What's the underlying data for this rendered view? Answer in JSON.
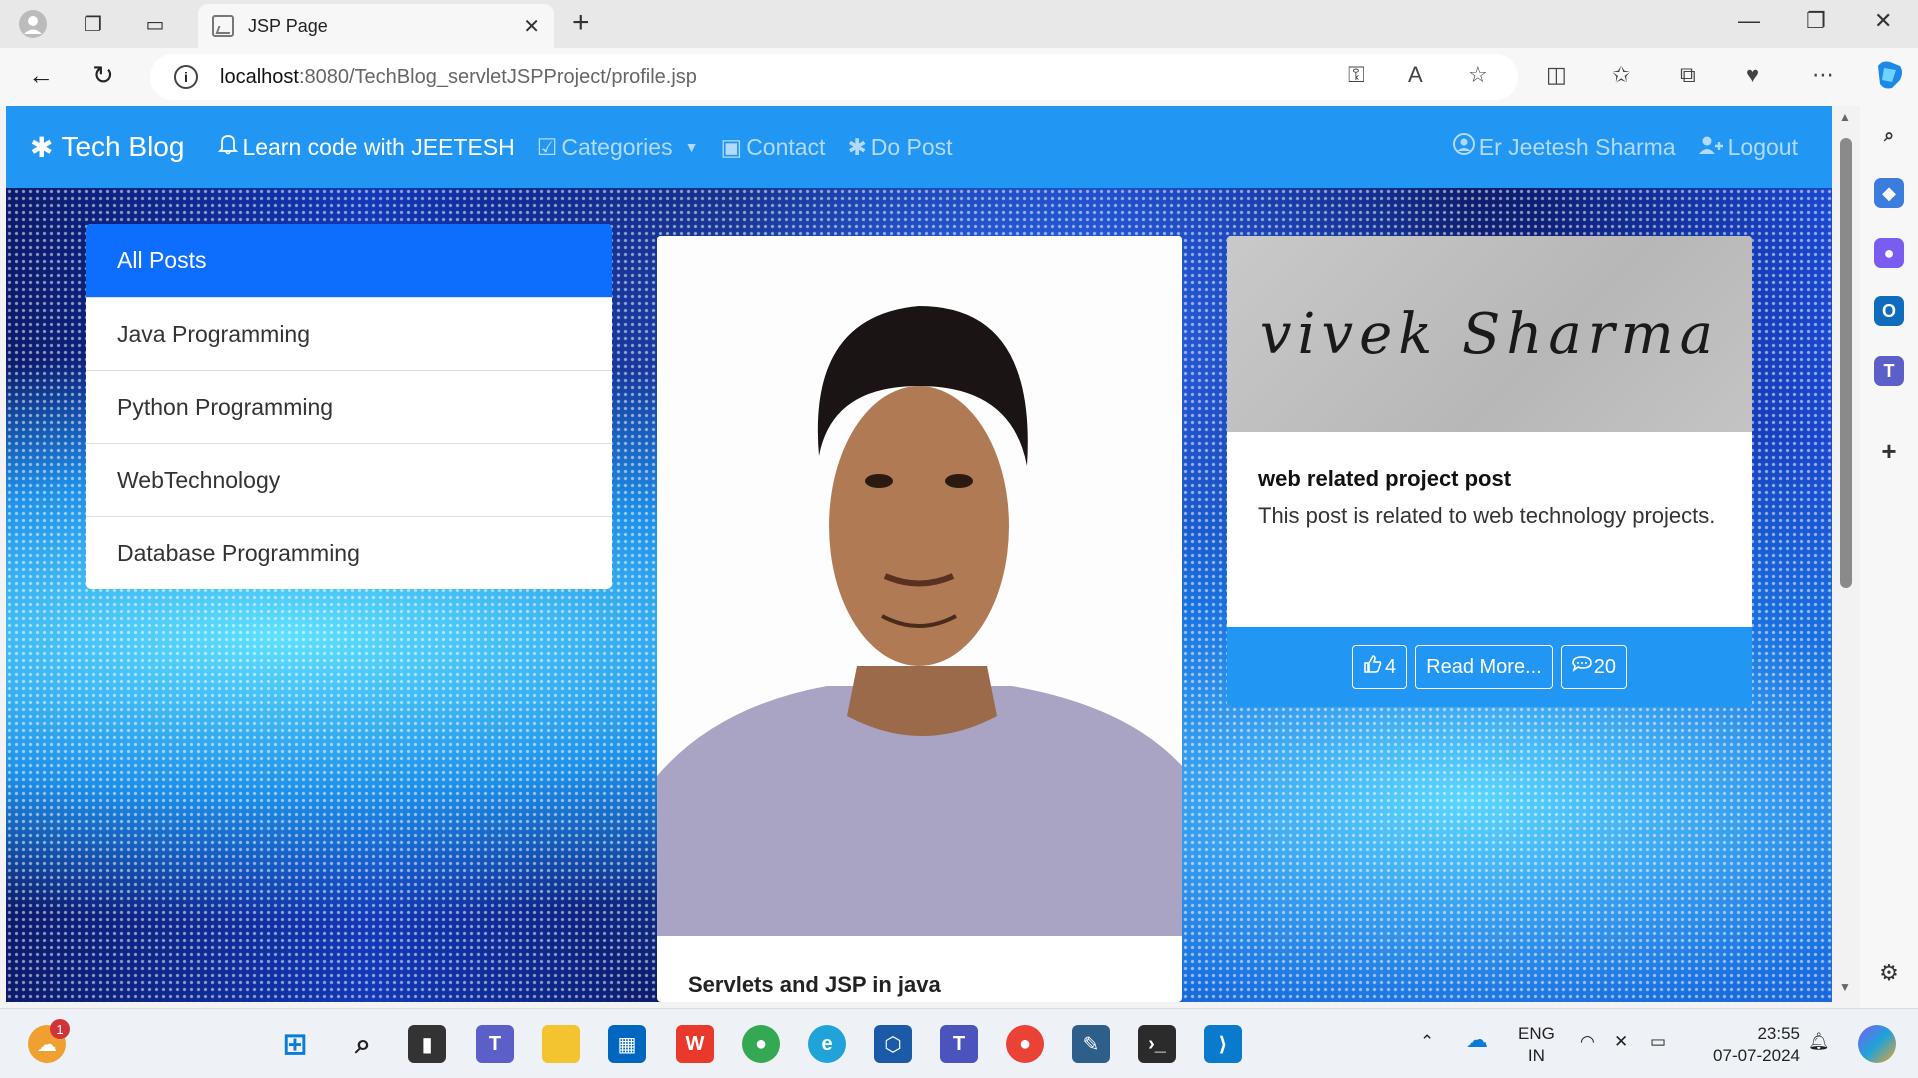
{
  "browser": {
    "tab_title": "JSP Page",
    "url_host": "localhost",
    "url_path": ":8080/TechBlog_servletJSPProject/profile.jsp"
  },
  "navbar": {
    "brand": "Tech Blog",
    "learn": "Learn code with JEETESH",
    "categories": "Categories",
    "contact": "Contact",
    "do_post": "Do Post",
    "user": "Er Jeetesh Sharma",
    "logout": "Logout"
  },
  "categories": [
    "All Posts",
    "Java Programming",
    "Python Programming",
    "WebTechnology",
    "Database Programming"
  ],
  "posts": [
    {
      "title": "Servlets and JSP in java"
    },
    {
      "title": "web related project post",
      "content": "This post is related to web technology projects.",
      "likes": "4",
      "read_more": "Read More...",
      "comments": "20",
      "image_text": "vivek Sharma"
    }
  ],
  "taskbar": {
    "notif_count": "1",
    "lang_top": "ENG",
    "lang_bottom": "IN",
    "time": "23:55",
    "date": "07-07-2024"
  },
  "colors": {
    "navbar": "#2196f3",
    "active_item": "#0d6efd"
  }
}
